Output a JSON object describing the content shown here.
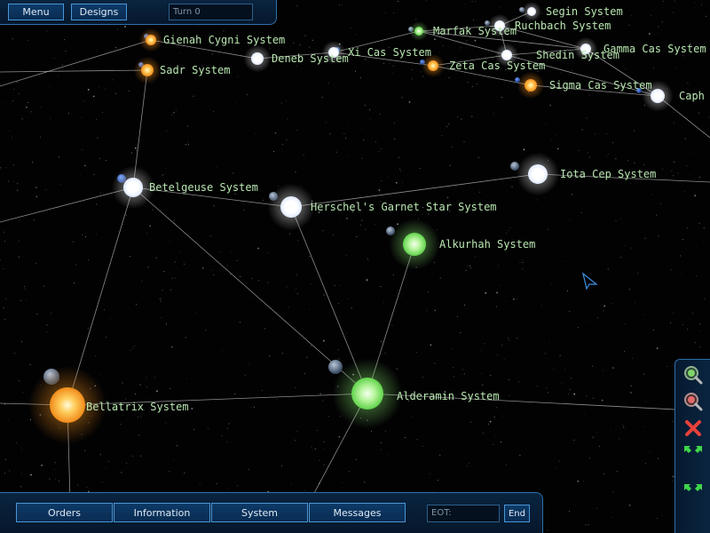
{
  "top_bar": {
    "menu_label": "Menu",
    "designs_label": "Designs",
    "turn_text": "Turn 0"
  },
  "bottom_bar": {
    "orders_label": "Orders",
    "information_label": "Information",
    "system_label": "System",
    "messages_label": "Messages",
    "eot_text": "EOT:",
    "end_label": "End"
  },
  "side_tools": [
    {
      "name": "zoom-in-icon"
    },
    {
      "name": "zoom-out-icon"
    },
    {
      "name": "close-icon"
    },
    {
      "name": "expand-icon"
    },
    {
      "name": "collapse-icon"
    }
  ],
  "colors": {
    "panel_border": "#2f6fa6",
    "label_text": "#b9e7b0",
    "lane": "#c8c8c8"
  },
  "systems": [
    {
      "id": "segin",
      "name": "Segin System",
      "star": "white"
    },
    {
      "id": "ruchbach",
      "name": "Ruchbach System",
      "star": "white"
    },
    {
      "id": "marfak",
      "name": "Marfak System",
      "star": "green"
    },
    {
      "id": "shedin",
      "name": "Shedin System",
      "star": "white"
    },
    {
      "id": "gamma_cas",
      "name": "Gamma Cas System",
      "star": "white"
    },
    {
      "id": "zeta_cas",
      "name": "Zeta Cas System",
      "star": "orange"
    },
    {
      "id": "sigma_cas",
      "name": "Sigma Cas System",
      "star": "orange"
    },
    {
      "id": "caph",
      "name": "Caph",
      "star": "white"
    },
    {
      "id": "xi_cas",
      "name": "Xi Cas System",
      "star": "white"
    },
    {
      "id": "gienah_cygni",
      "name": "Gienah Cygni System",
      "star": "orange"
    },
    {
      "id": "deneb",
      "name": "Deneb System",
      "star": "white"
    },
    {
      "id": "sadr",
      "name": "Sadr System",
      "star": "orange"
    },
    {
      "id": "betelgeuse",
      "name": "Betelgeuse System",
      "star": "white"
    },
    {
      "id": "iota_cep",
      "name": "Iota Cep System",
      "star": "white"
    },
    {
      "id": "herschels_garnet",
      "name": "Herschel's Garnet Star System",
      "star": "white"
    },
    {
      "id": "alkurhah",
      "name": "Alkurhah System",
      "star": "green"
    },
    {
      "id": "bellatrix",
      "name": "Bellatrix System",
      "star": "orange"
    },
    {
      "id": "alderamin",
      "name": "Alderamin System",
      "star": "green"
    }
  ],
  "lanes": [
    [
      "gienah_cygni",
      "deneb"
    ],
    [
      "deneb",
      "xi_cas"
    ],
    [
      "xi_cas",
      "marfak"
    ],
    [
      "xi_cas",
      "zeta_cas"
    ],
    [
      "marfak",
      "ruchbach"
    ],
    [
      "ruchbach",
      "segin"
    ],
    [
      "ruchbach",
      "shedin"
    ],
    [
      "ruchbach",
      "gamma_cas"
    ],
    [
      "marfak",
      "shedin"
    ],
    [
      "marfak",
      "gamma_cas"
    ],
    [
      "zeta_cas",
      "shedin"
    ],
    [
      "zeta_cas",
      "sigma_cas"
    ],
    [
      "sigma_cas",
      "caph"
    ],
    [
      "shedin",
      "gamma_cas"
    ],
    [
      "gamma_cas",
      "caph"
    ],
    [
      "shedin",
      "caph"
    ],
    [
      "sadr",
      "betelgeuse"
    ],
    [
      "betelgeuse",
      "herschels_garnet"
    ],
    [
      "betelgeuse",
      "bellatrix"
    ],
    [
      "betelgeuse",
      "alderamin"
    ],
    [
      "herschels_garnet",
      "iota_cep"
    ],
    [
      "herschels_garnet",
      "alderamin"
    ],
    [
      "alkurhah",
      "alderamin"
    ],
    [
      "bellatrix",
      "alderamin"
    ]
  ]
}
